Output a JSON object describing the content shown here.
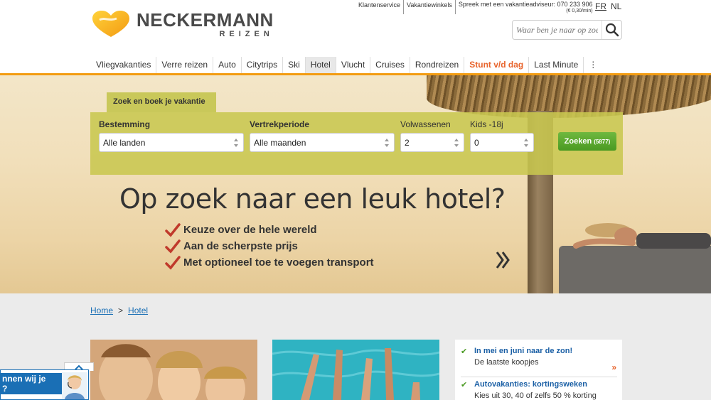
{
  "brand": {
    "name": "NECKERMANN",
    "sub": "REIZEN"
  },
  "toplinks": {
    "service": "Klantenservice",
    "shops": "Vakantiewinkels",
    "phone": "Spreek met een vakantieadviseur: 070 233 906",
    "phone_cost": "(€ 0,30/min)"
  },
  "lang": {
    "fr": "FR",
    "nl": "NL"
  },
  "search": {
    "placeholder": "Waar ben je naar op zoek?"
  },
  "nav": {
    "items": [
      "Vliegvakanties",
      "Verre reizen",
      "Auto",
      "Citytrips",
      "Ski",
      "Hotel",
      "Vlucht",
      "Cruises",
      "Rondreizen",
      "Stunt v/d dag",
      "Last Minute"
    ],
    "more": "⋮",
    "active": "Hotel",
    "accent": "Stunt v/d dag"
  },
  "booking": {
    "tab": "Zoek en boek je vakantie",
    "destination_label": "Bestemming",
    "destination_value": "Alle landen",
    "period_label": "Vertrekperiode",
    "period_value": "Alle maanden",
    "adults_label": "Volwassenen",
    "adults_value": "2",
    "kids_label": "Kids -18j",
    "kids_value": "0",
    "search_label": "Zoeken",
    "search_count": "(5877)"
  },
  "hero": {
    "headline": "Op zoek naar een leuk hotel?",
    "bullets": [
      "Keuze over de hele wereld",
      "Aan de scherpste prijs",
      "Met optioneel toe te voegen transport"
    ]
  },
  "breadcrumb": {
    "home": "Home",
    "sep": ">",
    "current": "Hotel"
  },
  "promos": [
    {
      "title": "In mei en juni naar de zon!",
      "sub": "De laatste koopjes",
      "arrow": "»"
    },
    {
      "title": "Autovakanties: kortingsweken",
      "sub": "Kies uit 30, 40 of zelfs 50 % korting"
    }
  ],
  "chat": {
    "line1": "nnen wij je",
    "line2": "?"
  },
  "colors": {
    "accent_orange": "#f39c12",
    "booking_bg": "#c9c85a",
    "link_blue": "#1a6fb5",
    "go_green": "#4a9a22"
  }
}
